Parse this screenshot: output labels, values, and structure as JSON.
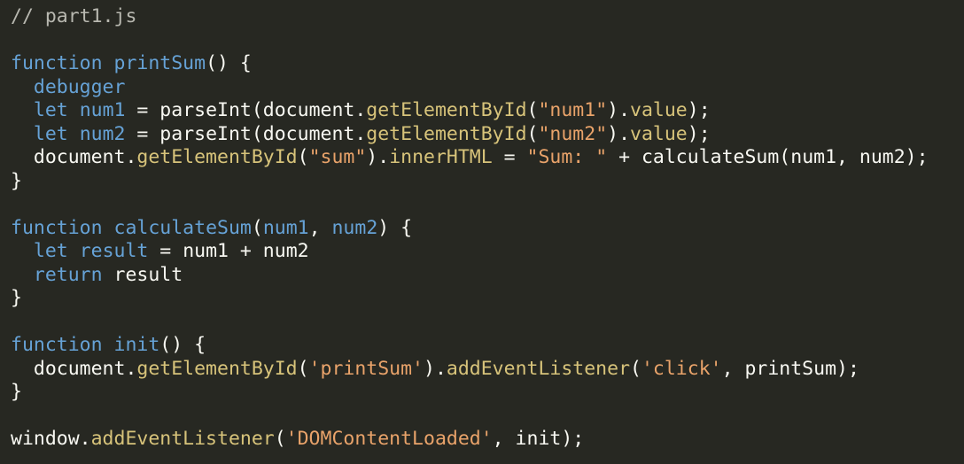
{
  "editor": {
    "background": "#272822",
    "colors": {
      "comment": "#b8b8b0",
      "keyword": "#66a2d6",
      "function_name": "#66a2d6",
      "method": "#d7c37a",
      "string": "#e9a36a",
      "plain": "#f8f8f2"
    },
    "lines": [
      [
        {
          "t": "comment",
          "v": "// part1.js"
        }
      ],
      [],
      [
        {
          "t": "keyword",
          "v": "function"
        },
        {
          "t": "plain",
          "v": " "
        },
        {
          "t": "fn",
          "v": "printSum"
        },
        {
          "t": "plain",
          "v": "() {"
        }
      ],
      [
        {
          "t": "plain",
          "v": "  "
        },
        {
          "t": "keyword",
          "v": "debugger"
        }
      ],
      [
        {
          "t": "plain",
          "v": "  "
        },
        {
          "t": "keyword",
          "v": "let"
        },
        {
          "t": "plain",
          "v": " "
        },
        {
          "t": "fn",
          "v": "num1"
        },
        {
          "t": "plain",
          "v": " = parseInt(document."
        },
        {
          "t": "method",
          "v": "getElementById"
        },
        {
          "t": "plain",
          "v": "("
        },
        {
          "t": "string",
          "v": "\"num1\""
        },
        {
          "t": "plain",
          "v": ")."
        },
        {
          "t": "method",
          "v": "value"
        },
        {
          "t": "plain",
          "v": ");"
        }
      ],
      [
        {
          "t": "plain",
          "v": "  "
        },
        {
          "t": "keyword",
          "v": "let"
        },
        {
          "t": "plain",
          "v": " "
        },
        {
          "t": "fn",
          "v": "num2"
        },
        {
          "t": "plain",
          "v": " = parseInt(document."
        },
        {
          "t": "method",
          "v": "getElementById"
        },
        {
          "t": "plain",
          "v": "("
        },
        {
          "t": "string",
          "v": "\"num2\""
        },
        {
          "t": "plain",
          "v": ")."
        },
        {
          "t": "method",
          "v": "value"
        },
        {
          "t": "plain",
          "v": ");"
        }
      ],
      [
        {
          "t": "plain",
          "v": "  document."
        },
        {
          "t": "method",
          "v": "getElementById"
        },
        {
          "t": "plain",
          "v": "("
        },
        {
          "t": "string",
          "v": "\"sum\""
        },
        {
          "t": "plain",
          "v": ")."
        },
        {
          "t": "method",
          "v": "innerHTML"
        },
        {
          "t": "plain",
          "v": " = "
        },
        {
          "t": "string",
          "v": "\"Sum: \""
        },
        {
          "t": "plain",
          "v": " + calculateSum(num1, num2);"
        }
      ],
      [
        {
          "t": "plain",
          "v": "}"
        }
      ],
      [],
      [
        {
          "t": "keyword",
          "v": "function"
        },
        {
          "t": "plain",
          "v": " "
        },
        {
          "t": "fn",
          "v": "calculateSum"
        },
        {
          "t": "plain",
          "v": "("
        },
        {
          "t": "fn",
          "v": "num1"
        },
        {
          "t": "plain",
          "v": ", "
        },
        {
          "t": "fn",
          "v": "num2"
        },
        {
          "t": "plain",
          "v": ") {"
        }
      ],
      [
        {
          "t": "plain",
          "v": "  "
        },
        {
          "t": "keyword",
          "v": "let"
        },
        {
          "t": "plain",
          "v": " "
        },
        {
          "t": "fn",
          "v": "result"
        },
        {
          "t": "plain",
          "v": " = num1 + num2"
        }
      ],
      [
        {
          "t": "plain",
          "v": "  "
        },
        {
          "t": "keyword",
          "v": "return"
        },
        {
          "t": "plain",
          "v": " result"
        }
      ],
      [
        {
          "t": "plain",
          "v": "}"
        }
      ],
      [],
      [
        {
          "t": "keyword",
          "v": "function"
        },
        {
          "t": "plain",
          "v": " "
        },
        {
          "t": "fn",
          "v": "init"
        },
        {
          "t": "plain",
          "v": "() {"
        }
      ],
      [
        {
          "t": "plain",
          "v": "  document."
        },
        {
          "t": "method",
          "v": "getElementById"
        },
        {
          "t": "plain",
          "v": "("
        },
        {
          "t": "string",
          "v": "'printSum'"
        },
        {
          "t": "plain",
          "v": ")."
        },
        {
          "t": "method",
          "v": "addEventListener"
        },
        {
          "t": "plain",
          "v": "("
        },
        {
          "t": "string",
          "v": "'click'"
        },
        {
          "t": "plain",
          "v": ", printSum);"
        }
      ],
      [
        {
          "t": "plain",
          "v": "}"
        }
      ],
      [],
      [
        {
          "t": "plain",
          "v": "window."
        },
        {
          "t": "method",
          "v": "addEventListener"
        },
        {
          "t": "plain",
          "v": "("
        },
        {
          "t": "string",
          "v": "'DOMContentLoaded'"
        },
        {
          "t": "plain",
          "v": ", init);"
        }
      ]
    ]
  }
}
